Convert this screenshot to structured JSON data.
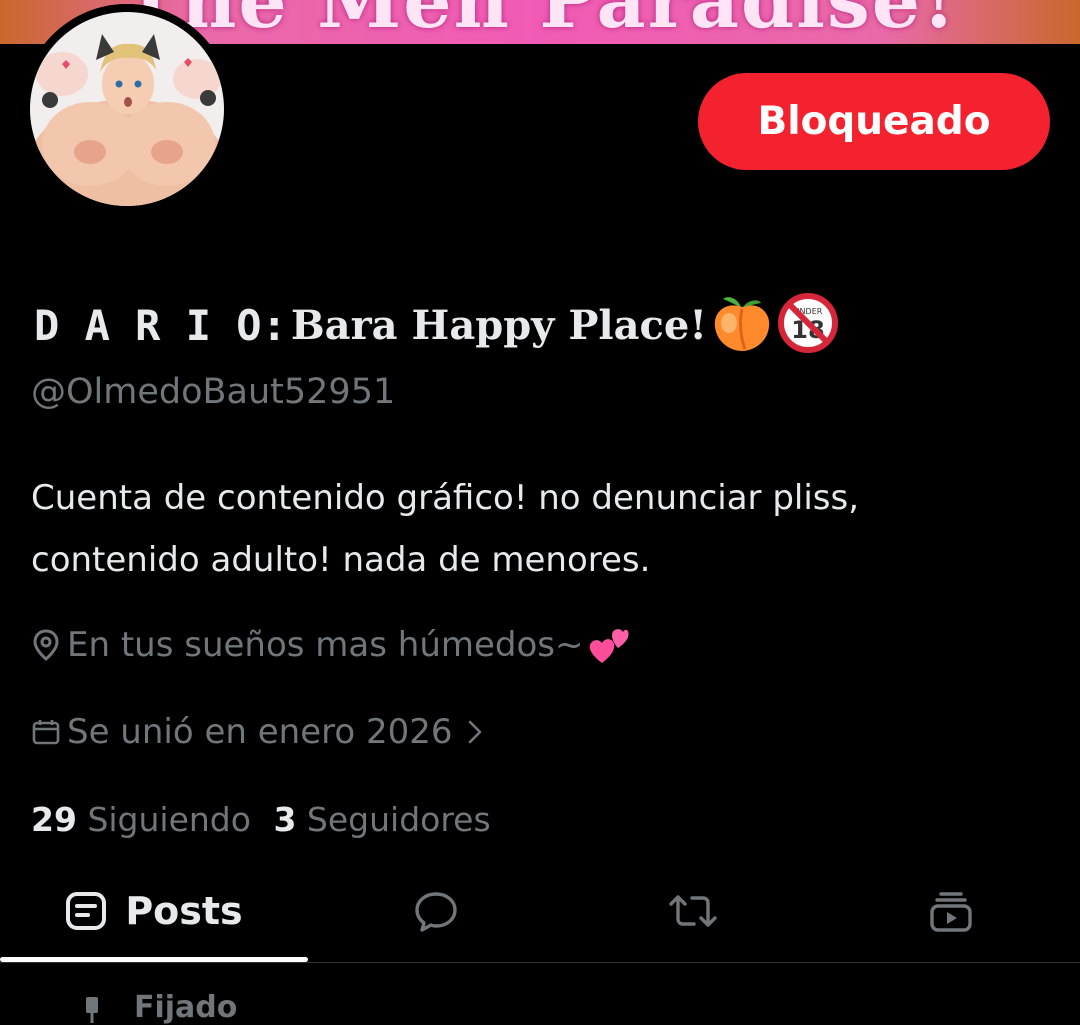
{
  "banner": {
    "text": "The Men Paradise!"
  },
  "profile": {
    "display_name_main": "D A R I O:",
    "display_name_sub": "Bara Happy Place!",
    "handle": "@OlmedoBaut52951",
    "bio_line1": "Cuenta de contenido gráfico! no denunciar pliss,",
    "bio_line2": "contenido adulto! nada de menores.",
    "location": "En tus sueños mas húmedos~",
    "joined": "Se unió en enero 2026",
    "following_count": "29",
    "following_label": "Siguiendo",
    "followers_count": "3",
    "followers_label": "Seguidores"
  },
  "actions": {
    "block_label": "Bloqueado"
  },
  "tabs": {
    "posts_label": "Posts"
  },
  "pinned": {
    "label": "Fijado"
  },
  "colors": {
    "background": "#000000",
    "block_button": "#f4212e",
    "secondary_text": "#71767b",
    "primary_text": "#e7e9ea"
  },
  "icons": {
    "location": "location-pin-icon",
    "calendar": "calendar-icon",
    "chevron": "chevron-right-icon",
    "posts_tab": "posts-icon",
    "replies_tab": "speech-bubble-icon",
    "reposts_tab": "repost-icon",
    "media_tab": "video-stack-icon",
    "peach_emoji": "peach-emoji-icon",
    "no_under_18_emoji": "no-under-18-icon",
    "hearts_emoji": "two-hearts-emoji-icon"
  }
}
